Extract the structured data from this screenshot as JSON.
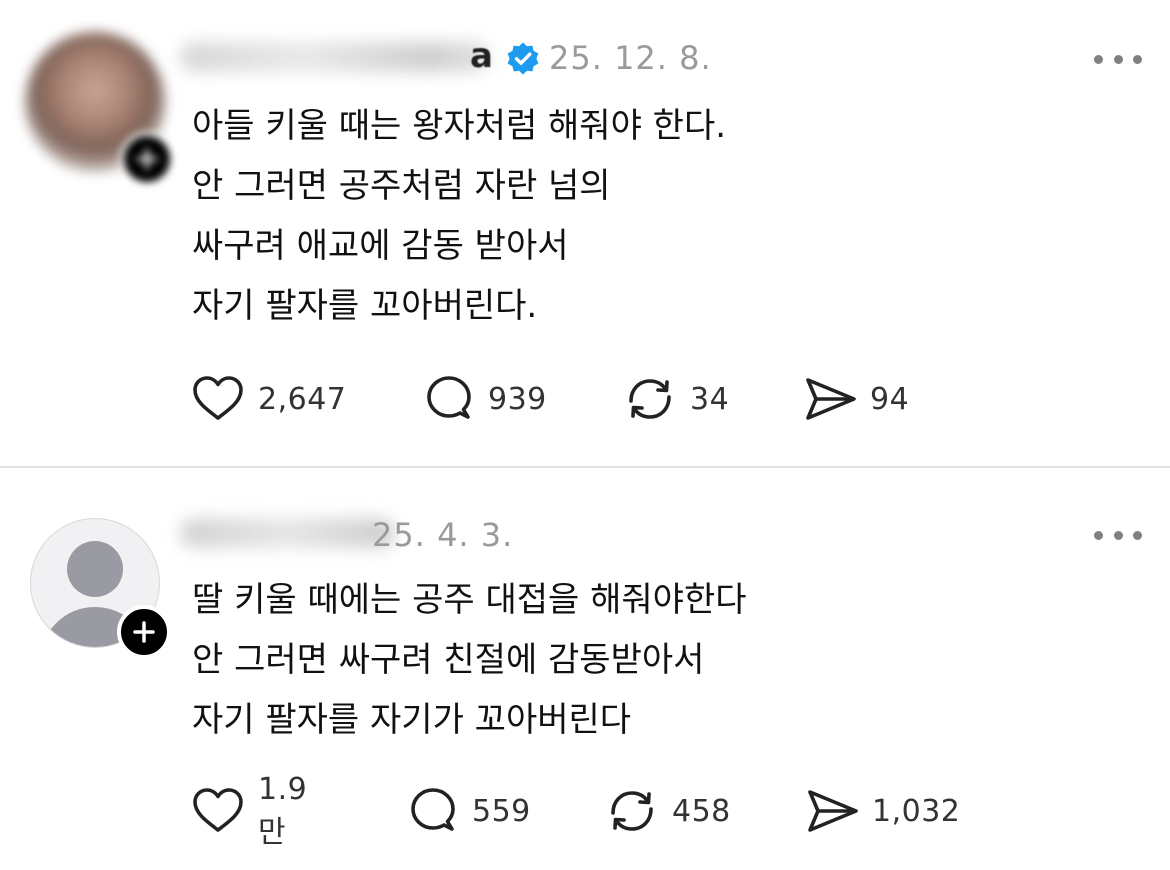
{
  "posts": [
    {
      "username_visible": "a",
      "verified": true,
      "date": "25. 12. 8.",
      "lines": [
        "아들 키울 때는 왕자처럼 해줘야 한다.",
        "안 그러면 공주처럼 자란 넘의",
        "싸구려 애교에 감동 받아서",
        "자기 팔자를 꼬아버린다."
      ],
      "stats": {
        "likes": "2,647",
        "replies": "939",
        "reposts": "34",
        "shares": "94"
      }
    },
    {
      "date": "25. 4. 3.",
      "lines": [
        "딸 키울 때에는 공주 대접을 해줘야한다",
        "안 그러면 싸구려 친절에 감동받아서",
        "자기 팔자를 자기가 꼬아버린다"
      ],
      "stats": {
        "likes": "1.9만",
        "replies": "559",
        "reposts": "458",
        "shares": "1,032"
      }
    }
  ],
  "icons": {
    "like": "heart-icon",
    "reply": "comment-bubble-icon",
    "repost": "repost-arrows-icon",
    "share": "send-paper-plane-icon",
    "more": "more-dots-icon",
    "verified": "verified-badge-icon",
    "follow": "plus-icon"
  },
  "colors": {
    "verified": "#1d9bf0",
    "date": "#9a9a9a",
    "divider": "#e3e3e3"
  }
}
